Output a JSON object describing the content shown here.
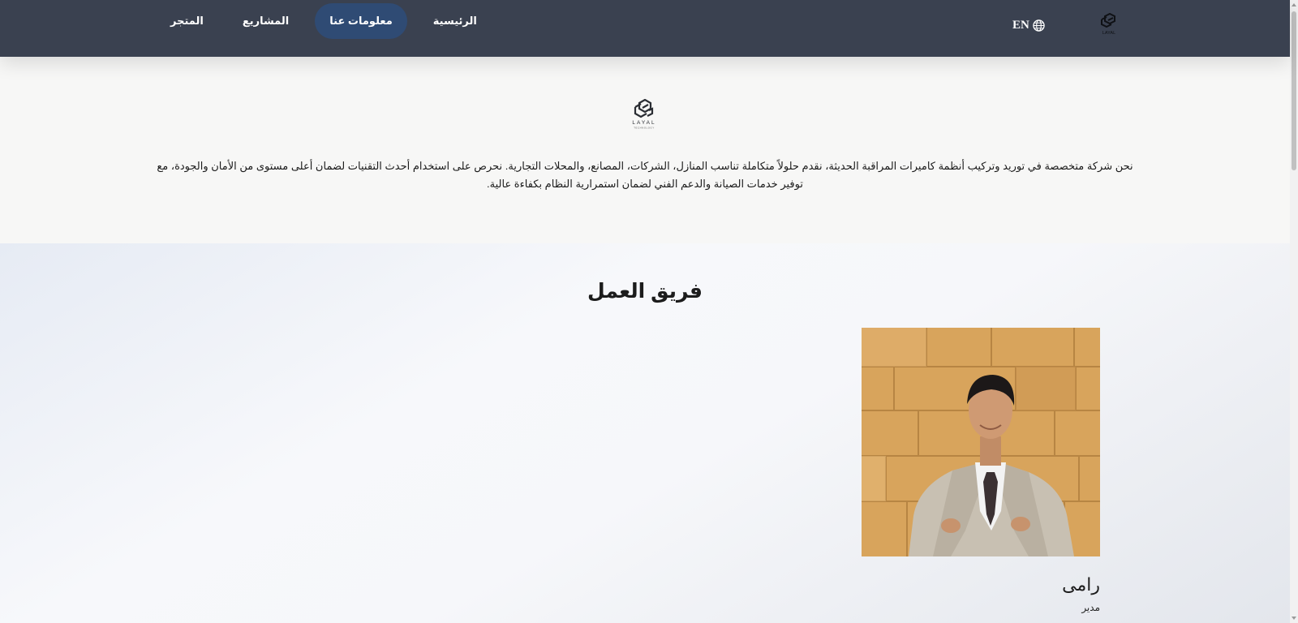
{
  "header": {
    "nav": [
      {
        "label": "الرئيسية",
        "active": false
      },
      {
        "label": "معلومات عنا",
        "active": true
      },
      {
        "label": "المشاريع",
        "active": false
      },
      {
        "label": "المتجر",
        "active": false
      }
    ],
    "language_label": "EN",
    "logo_text": "LAYAL"
  },
  "about": {
    "logo_text": "LAYAL",
    "logo_subtext": "TECHNOLOGY",
    "description": "نحن شركة متخصصة في توريد وتركيب أنظمة كاميرات المراقبة الحديثة، نقدم حلولاً متكاملة تناسب المنازل، الشركات، المصانع، والمحلات التجارية. نحرص على استخدام أحدث التقنيات لضمان أعلى مستوى من الأمان والجودة، مع توفير خدمات الصيانة والدعم الفني لضمان استمرارية النظام بكفاءة عالية."
  },
  "team": {
    "title": "فريق العمل",
    "members": [
      {
        "name": "رامى",
        "role": "مدير"
      }
    ]
  },
  "colors": {
    "header_bg": "#3a4150",
    "active_nav_bg": "#2f4b74",
    "about_bg": "#f7f7f6",
    "photo_wall": "#d9a862"
  },
  "icons": {
    "language": "globe-icon",
    "logo": "layal-logo-icon"
  }
}
